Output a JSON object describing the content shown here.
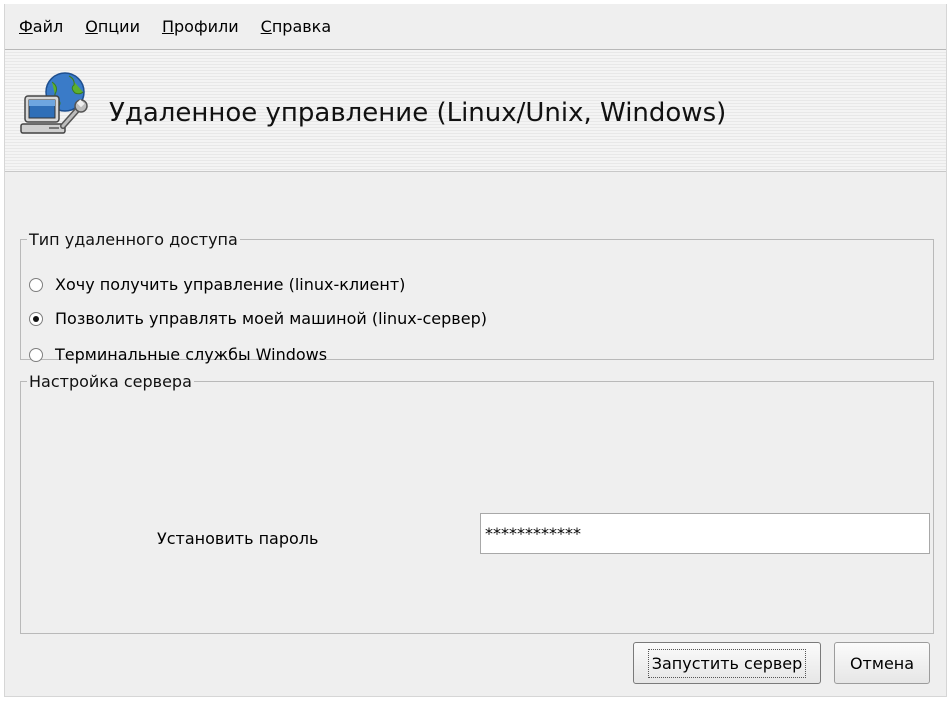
{
  "menu": {
    "items": [
      {
        "accel": "Ф",
        "rest": "айл"
      },
      {
        "accel": "О",
        "rest": "пции"
      },
      {
        "accel": "П",
        "rest": "рофили"
      },
      {
        "accel": "С",
        "rest": "правка"
      }
    ]
  },
  "header": {
    "icon": "remote-control-computer-icon",
    "title": "Удаленное управление (Linux/Unix, Windows)"
  },
  "access": {
    "legend": "Тип удаленного доступа",
    "options": [
      {
        "label": "Хочу получить управление (linux-клиент)",
        "selected": false
      },
      {
        "label": "Позволить управлять моей машиной (linux-сервер)",
        "selected": true
      },
      {
        "label": "Терминальные службы Windows",
        "selected": false
      }
    ]
  },
  "server": {
    "legend": "Настройка сервера",
    "password_label": "Установить пароль",
    "password_value": "************"
  },
  "buttons": {
    "start": "Запустить сервер",
    "cancel": "Отмена"
  }
}
